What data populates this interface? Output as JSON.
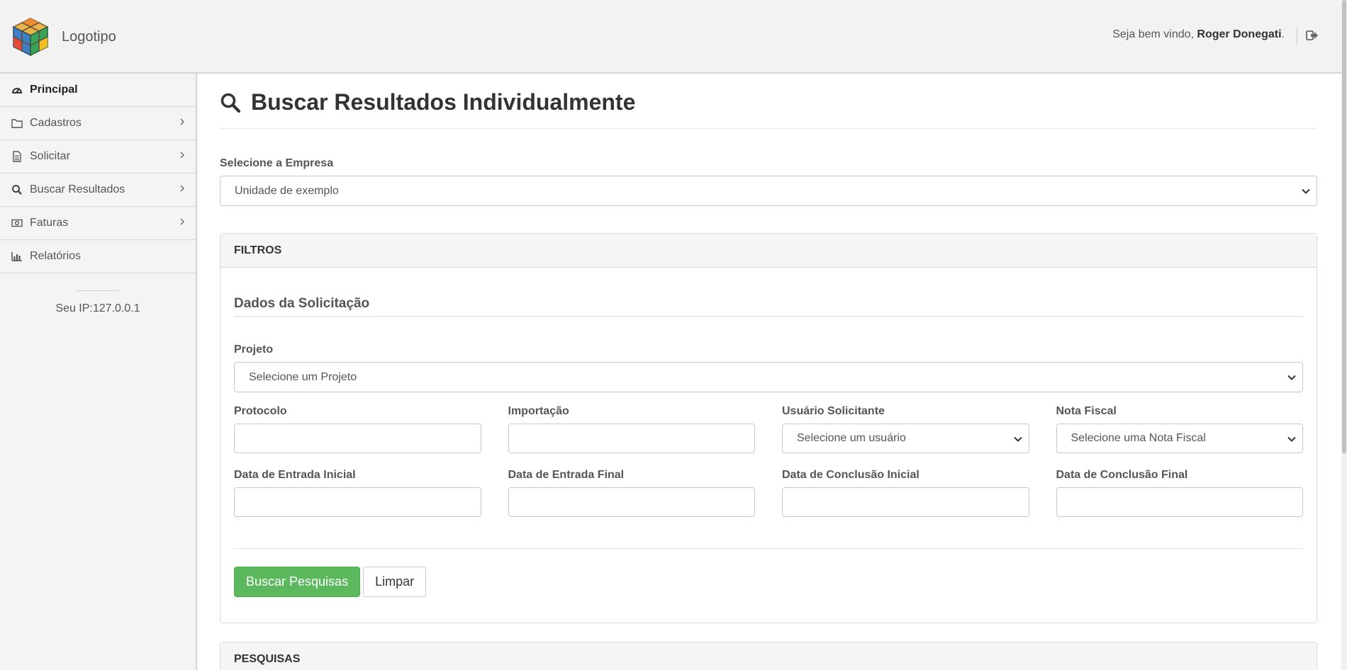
{
  "header": {
    "logo_text": "Logotipo",
    "welcome_prefix": "Seja bem vindo, ",
    "user_name": "Roger Donegati",
    "welcome_suffix": "."
  },
  "sidebar": {
    "items": [
      {
        "label": "Principal",
        "icon": "dashboard-icon",
        "active": true,
        "has_children": false
      },
      {
        "label": "Cadastros",
        "icon": "folder-icon",
        "active": false,
        "has_children": true
      },
      {
        "label": "Solicitar",
        "icon": "document-icon",
        "active": false,
        "has_children": true
      },
      {
        "label": "Buscar Resultados",
        "icon": "search-icon",
        "active": false,
        "has_children": true
      },
      {
        "label": "Faturas",
        "icon": "money-icon",
        "active": false,
        "has_children": true
      },
      {
        "label": "Relatórios",
        "icon": "bar-chart-icon",
        "active": false,
        "has_children": false
      }
    ],
    "ip_text": "Seu IP:127.0.0.1"
  },
  "main": {
    "title": "Buscar Resultados Individualmente",
    "empresa_label": "Selecione a Empresa",
    "empresa_value": "Unidade de exemplo",
    "filters": {
      "panel_title": "FILTROS",
      "legend": "Dados da Solicitação",
      "projeto_label": "Projeto",
      "projeto_value": "Selecione um Projeto",
      "protocolo_label": "Protocolo",
      "protocolo_value": "",
      "importacao_label": "Importação",
      "importacao_value": "",
      "usuario_label": "Usuário Solicitante",
      "usuario_value": "Selecione um usuário",
      "nota_label": "Nota Fiscal",
      "nota_value": "Selecione uma Nota Fiscal",
      "entrada_inicial_label": "Data de Entrada Inicial",
      "entrada_final_label": "Data de Entrada Final",
      "conclusao_inicial_label": "Data de Conclusão Inicial",
      "conclusao_final_label": "Data de Conclusão Final",
      "search_button": "Buscar Pesquisas",
      "clear_button": "Limpar"
    },
    "results_panel_title": "PESQUISAS"
  },
  "colors": {
    "primary_button": "#5cb85c",
    "topbar_bg": "#f2f2f2",
    "sidebar_bg": "#f4f4f4"
  }
}
